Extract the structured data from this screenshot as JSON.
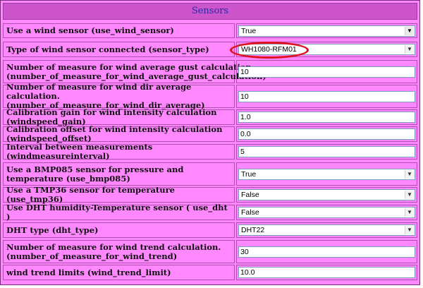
{
  "header": {
    "title": "Sensors"
  },
  "rows": [
    {
      "label": "Use a wind sensor (use_wind_sensor)",
      "type": "select",
      "value": "True"
    },
    {
      "label": "Type of wind sensor connected (sensor_type)",
      "type": "select",
      "value": "WH1080-RFM01"
    },
    {
      "label": "Number of measure for wind average gust calculation. (number_of_measure_for_wind_average_gust_calculation)",
      "type": "input",
      "value": "10"
    },
    {
      "label": "Number of measure for wind dir average calculation. (number_of_measure_for_wind_dir_average)",
      "type": "input",
      "value": "10"
    },
    {
      "label": "Calibration gain for wind intensity calculation (windspeed_gain)",
      "type": "input",
      "value": "1.0"
    },
    {
      "label": "Calibration offset for wind intensity calculation (windspeed_offset)",
      "type": "input",
      "value": "0.0"
    },
    {
      "label": "Interval between measurements (windmeasureinterval)",
      "type": "input",
      "value": "5"
    },
    {
      "label": "Use a BMP085 sensor for pressure and temperature (use_bmp085)",
      "type": "select",
      "value": "True"
    },
    {
      "label": "Use a TMP36 sensor for temperature (use_tmp36)",
      "type": "select",
      "value": "False"
    },
    {
      "label": "Use DHT humidity-Temperature sensor ( use_dht )",
      "type": "select",
      "value": "False"
    },
    {
      "label": "DHT type (dht_type)",
      "type": "select",
      "value": "DHT22"
    },
    {
      "label": "Number of measure for wind trend calculation. (number_of_measure_for_wind_trend)",
      "type": "input",
      "value": "30"
    },
    {
      "label": "wind trend limits (wind_trend_limit)",
      "type": "input",
      "value": "10.0"
    }
  ],
  "icons": {
    "dropdown_arrow": "chevron-down-icon"
  },
  "colors": {
    "panel": "#ff88ff",
    "header": "#cc55cc",
    "header_text": "#2a2aa8",
    "highlight_circle": "#e0101c"
  }
}
